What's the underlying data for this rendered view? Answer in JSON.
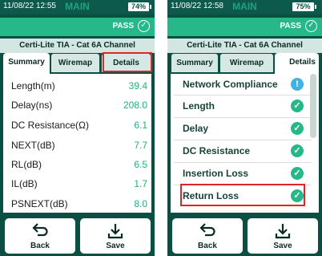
{
  "left": {
    "status": {
      "time": "11/08/22 12:55",
      "mode": "MAIN",
      "battery": "74%"
    },
    "result": {
      "label": "PASS",
      "icon": "check-circle-icon"
    },
    "subtitle": "Certi-Lite TIA - Cat 6A Channel",
    "tabs": [
      {
        "label": "Summary",
        "active": true
      },
      {
        "label": "Wiremap",
        "active": false
      },
      {
        "label": "Details",
        "active": false
      }
    ],
    "measurements": [
      {
        "label": "Length(m)",
        "value": "39.4"
      },
      {
        "label": "Delay(ns)",
        "value": "208.0"
      },
      {
        "label": "DC Resistance(Ω)",
        "value": "6.1"
      },
      {
        "label": "NEXT(dB)",
        "value": "7.7"
      },
      {
        "label": "RL(dB)",
        "value": "6.5"
      },
      {
        "label": "IL(dB)",
        "value": "1.7"
      },
      {
        "label": "PSNEXT(dB)",
        "value": "8.0"
      }
    ],
    "buttons": {
      "back": "Back",
      "save": "Save"
    }
  },
  "right": {
    "status": {
      "time": "11/08/22 12:58",
      "mode": "MAIN",
      "battery": "75%"
    },
    "result": {
      "label": "PASS",
      "icon": "check-circle-icon"
    },
    "subtitle": "Certi-Lite TIA - Cat 6A Channel",
    "tabs": [
      {
        "label": "Summary",
        "active": false
      },
      {
        "label": "Wiremap",
        "active": false
      },
      {
        "label": "Details",
        "active": true
      }
    ],
    "results": [
      {
        "label": "Network Compliance",
        "status": "info",
        "icon": "info-icon",
        "glyph": "!"
      },
      {
        "label": "Length",
        "status": "pass",
        "icon": "check-icon",
        "glyph": "✓"
      },
      {
        "label": "Delay",
        "status": "pass",
        "icon": "check-icon",
        "glyph": "✓"
      },
      {
        "label": "DC Resistance",
        "status": "pass",
        "icon": "check-icon",
        "glyph": "✓"
      },
      {
        "label": "Insertion Loss",
        "status": "pass",
        "icon": "check-icon",
        "glyph": "✓"
      },
      {
        "label": "Return Loss",
        "status": "pass",
        "icon": "check-icon",
        "glyph": "✓"
      }
    ],
    "buttons": {
      "back": "Back",
      "save": "Save"
    }
  },
  "colors": {
    "header": "#0b4f43",
    "pass": "#27b889",
    "value": "#23b07f",
    "highlight": "#e0242c",
    "info": "#3fb4e4"
  }
}
